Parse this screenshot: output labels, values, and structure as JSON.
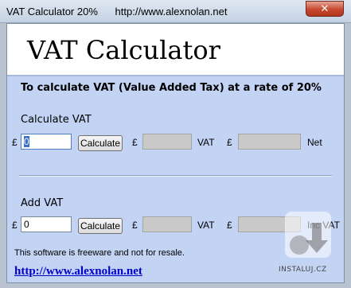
{
  "window": {
    "title": "VAT Calculator 20%      http://www.alexnolan.net",
    "close_label": "✕"
  },
  "app": {
    "title": "VAT Calculator",
    "subtitle": "To calculate VAT (Value Added Tax) at a rate of 20%"
  },
  "calculate_section": {
    "title": "Calculate VAT",
    "currency": "£",
    "input_value": "0",
    "button_label": "Calculate",
    "vat_label": "VAT",
    "net_label": "Net"
  },
  "add_section": {
    "title": "Add VAT",
    "currency": "£",
    "input_value": "0",
    "button_label": "Calculate",
    "vat_label": "VAT",
    "total_label": "Inc VAT"
  },
  "footer": {
    "notice": "This software is freeware and not for resale.",
    "link": "http://www.alexnolan.net"
  },
  "watermark": {
    "text": "INSTALUJ.CZ"
  }
}
